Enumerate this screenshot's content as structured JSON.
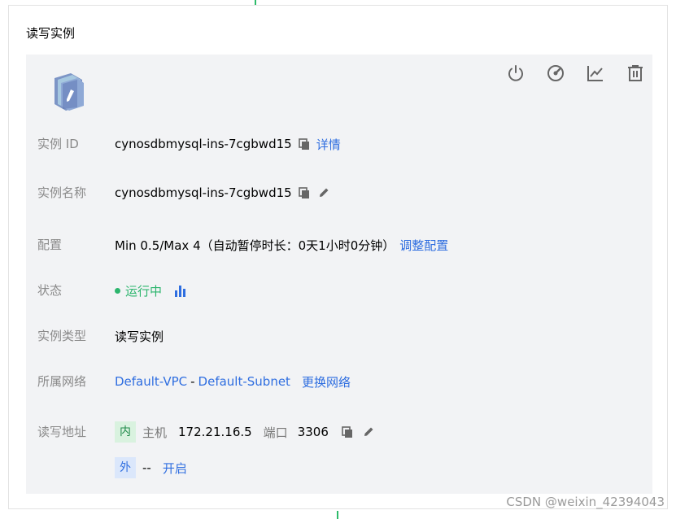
{
  "section": {
    "title": "读写实例"
  },
  "icons": {
    "db": "database-instance-icon",
    "power": "power-icon",
    "speed": "gauge-icon",
    "chart": "line-chart-icon",
    "delete": "trash-icon",
    "copy": "copy-icon",
    "edit": "pencil-icon",
    "monitor": "bar-chart-icon"
  },
  "rows": {
    "instance_id": {
      "label": "实例 ID",
      "value": "cynosdbmysql-ins-7cgbwd15",
      "link": "详情"
    },
    "instance_name": {
      "label": "实例名称",
      "value": "cynosdbmysql-ins-7cgbwd15"
    },
    "config": {
      "label": "配置",
      "value": "Min 0.5/Max 4（自动暂停时长：0天1小时0分钟）",
      "link": "调整配置"
    },
    "status": {
      "label": "状态",
      "value": "运行中"
    },
    "type": {
      "label": "实例类型",
      "value": "读写实例"
    },
    "network": {
      "label": "所属网络",
      "vpc": "Default-VPC",
      "sep": "-",
      "subnet": "Default-Subnet",
      "link": "更换网络"
    },
    "address": {
      "label": "读写地址",
      "inner_tag": "内",
      "host_label": "主机",
      "host": "172.21.16.5",
      "port_label": "端口",
      "port": "3306",
      "outer_tag": "外",
      "outer_value": "--",
      "outer_link": "开启"
    }
  },
  "watermark": "CSDN @weixin_42394043",
  "colors": {
    "panel": "#f2f3f5",
    "link": "#2f6ee0",
    "running": "#2cb56d",
    "label": "#8a8a8a"
  }
}
